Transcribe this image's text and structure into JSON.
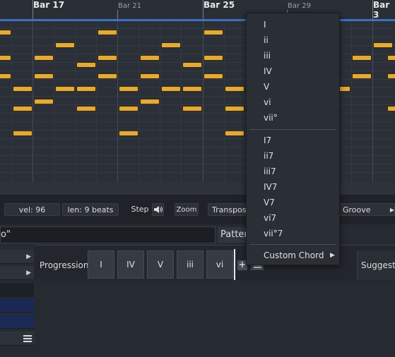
{
  "ruler": {
    "bars_major": [
      "Bar 17",
      "Bar 25",
      "Bar 3"
    ],
    "bars_minor": [
      "Bar 21",
      "Bar 29"
    ]
  },
  "statusbar": {
    "velocity": "vel: 96",
    "length": "len: 9 beats",
    "step": "Step",
    "zoom": "Zoom",
    "transpose": "Transpos",
    "groove": "Groove"
  },
  "pattern": {
    "name_value": "o\"",
    "tab_label": "Patter"
  },
  "progression": {
    "label": "Progression:",
    "chords": [
      "I",
      "IV",
      "V",
      "iii",
      "vi"
    ],
    "suggestions_label": "Suggesti"
  },
  "chord_menu": {
    "triads": [
      "I",
      "ii",
      "iii",
      "IV",
      "V",
      "vi",
      "vii°"
    ],
    "sevenths": [
      "I7",
      "ii7",
      "iii7",
      "IV7",
      "V7",
      "vi7",
      "vii°7"
    ],
    "custom": "Custom Chord"
  },
  "icons": {
    "speaker": "speaker-icon",
    "hamburger": "hamburger-icon",
    "add": "plus-icon",
    "submenu": "triangle-right-icon"
  },
  "colors": {
    "note": "#e3a93a",
    "playhead_line": "#3f6fc4",
    "background": "#262a31"
  }
}
